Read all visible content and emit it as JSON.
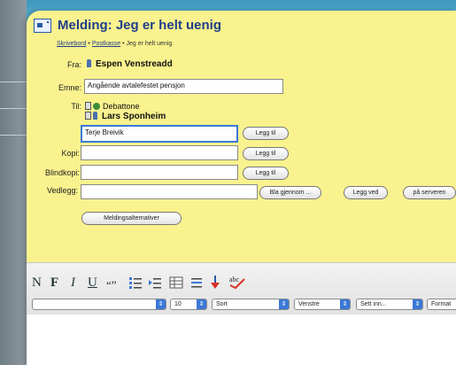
{
  "window": {
    "title": "Melding: Jeg er helt uenig"
  },
  "breadcrumb": {
    "item1": "Skrivebord",
    "sep": "•",
    "item2": "Postkasse",
    "current": "Jeg er helt uenig"
  },
  "form": {
    "from_label": "Fra:",
    "from_value": "Espen Venstreadd",
    "subject_label": "Emne:",
    "subject_value": "Angående avtalefestet pensjon",
    "to_label": "Til:",
    "recipients": [
      "Debattone",
      "Lars Sponheim"
    ],
    "to_input_value": "Terje Breivik",
    "copy_label": "Kopi:",
    "copy_value": "",
    "bcc_label": "Blindkopi:",
    "bcc_value": "",
    "add_label": "Legg til",
    "attachment_label": "Vedlegg:",
    "browse_label": "Bla gjennom ...",
    "attach_label": "Legg ved",
    "later_label": "på serveren",
    "message_options_label": "Meldingsalternativer"
  },
  "format_toolbar": {
    "bold": "N",
    "bold2": "F",
    "italic": "I",
    "underline": "U",
    "quote": "“”"
  },
  "selects": {
    "font": "",
    "size": "10",
    "color": "Sort",
    "align": "Venstre",
    "insert": "Sett inn...",
    "format": "Format"
  }
}
